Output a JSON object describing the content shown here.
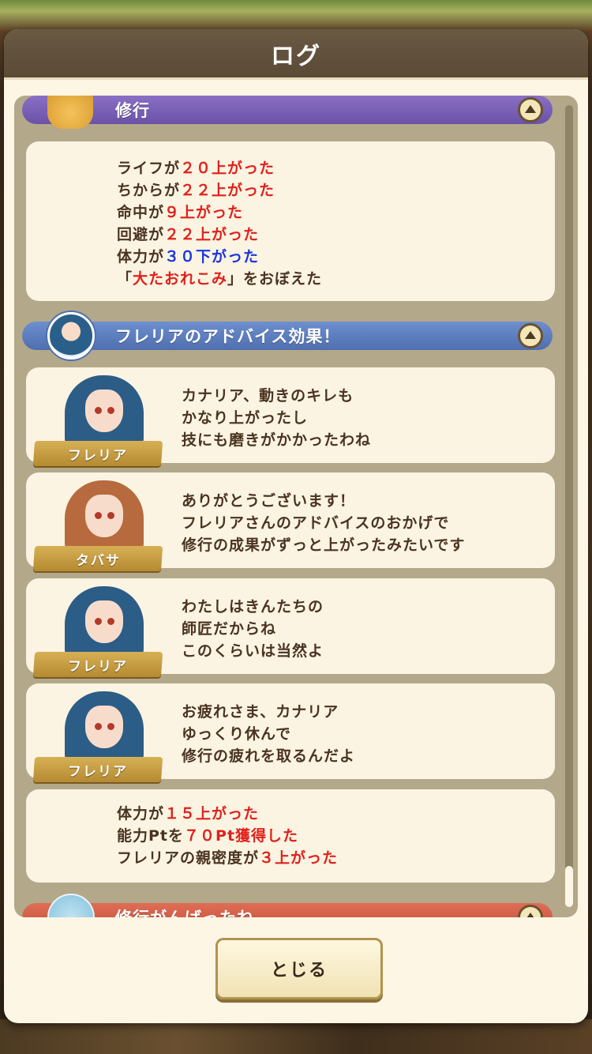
{
  "dialog": {
    "title": "ログ",
    "close_label": "とじる"
  },
  "sections": {
    "training": {
      "title": "修行"
    },
    "advice": {
      "title": "フレリアのアドバイス効果！"
    },
    "next": {
      "title": "修行がんばったね"
    }
  },
  "training_stats": [
    {
      "pre": "ライフが",
      "val": "２０上がった",
      "color": "red"
    },
    {
      "pre": "ちからが",
      "val": "２２上がった",
      "color": "red"
    },
    {
      "pre": "命中が",
      "val": "９上がった",
      "color": "red"
    },
    {
      "pre": "回避が",
      "val": "２２上がった",
      "color": "red"
    },
    {
      "pre": "体力が",
      "val": "３０下がった",
      "color": "blue"
    }
  ],
  "learned": {
    "open": "「",
    "skill": "大たおれこみ",
    "close": "」をおぼえた"
  },
  "dialogues": [
    {
      "speaker": "フレリア",
      "lines": [
        "カナリア、動きのキレも",
        "かなり上がったし",
        "技にも磨きがかかったわね"
      ]
    },
    {
      "speaker": "タバサ",
      "lines": [
        "ありがとうございます！",
        "フレリアさんのアドバイスのおかげで",
        "修行の成果がずっと上がったみたいです"
      ]
    },
    {
      "speaker": "フレリア",
      "lines": [
        "わたしはきんたちの",
        "師匠だからね",
        "このくらいは当然よ"
      ]
    },
    {
      "speaker": "フレリア",
      "lines": [
        "お疲れさま、カナリア",
        "ゆっくり休んで",
        "修行の疲れを取るんだよ"
      ]
    }
  ],
  "advice_results": [
    {
      "pre": "体力が",
      "val": "１５上がった"
    },
    {
      "pre": "能力Ptを",
      "val": "７０Pt獲得した"
    },
    {
      "pre": "フレリアの親密度が",
      "val": "３上がった"
    }
  ],
  "colors": {
    "accent_red": "#e0211c",
    "accent_blue": "#1a34e0",
    "header_purple": "#6a52a8",
    "header_blue": "#4f6fae",
    "header_red": "#c24f3a"
  }
}
